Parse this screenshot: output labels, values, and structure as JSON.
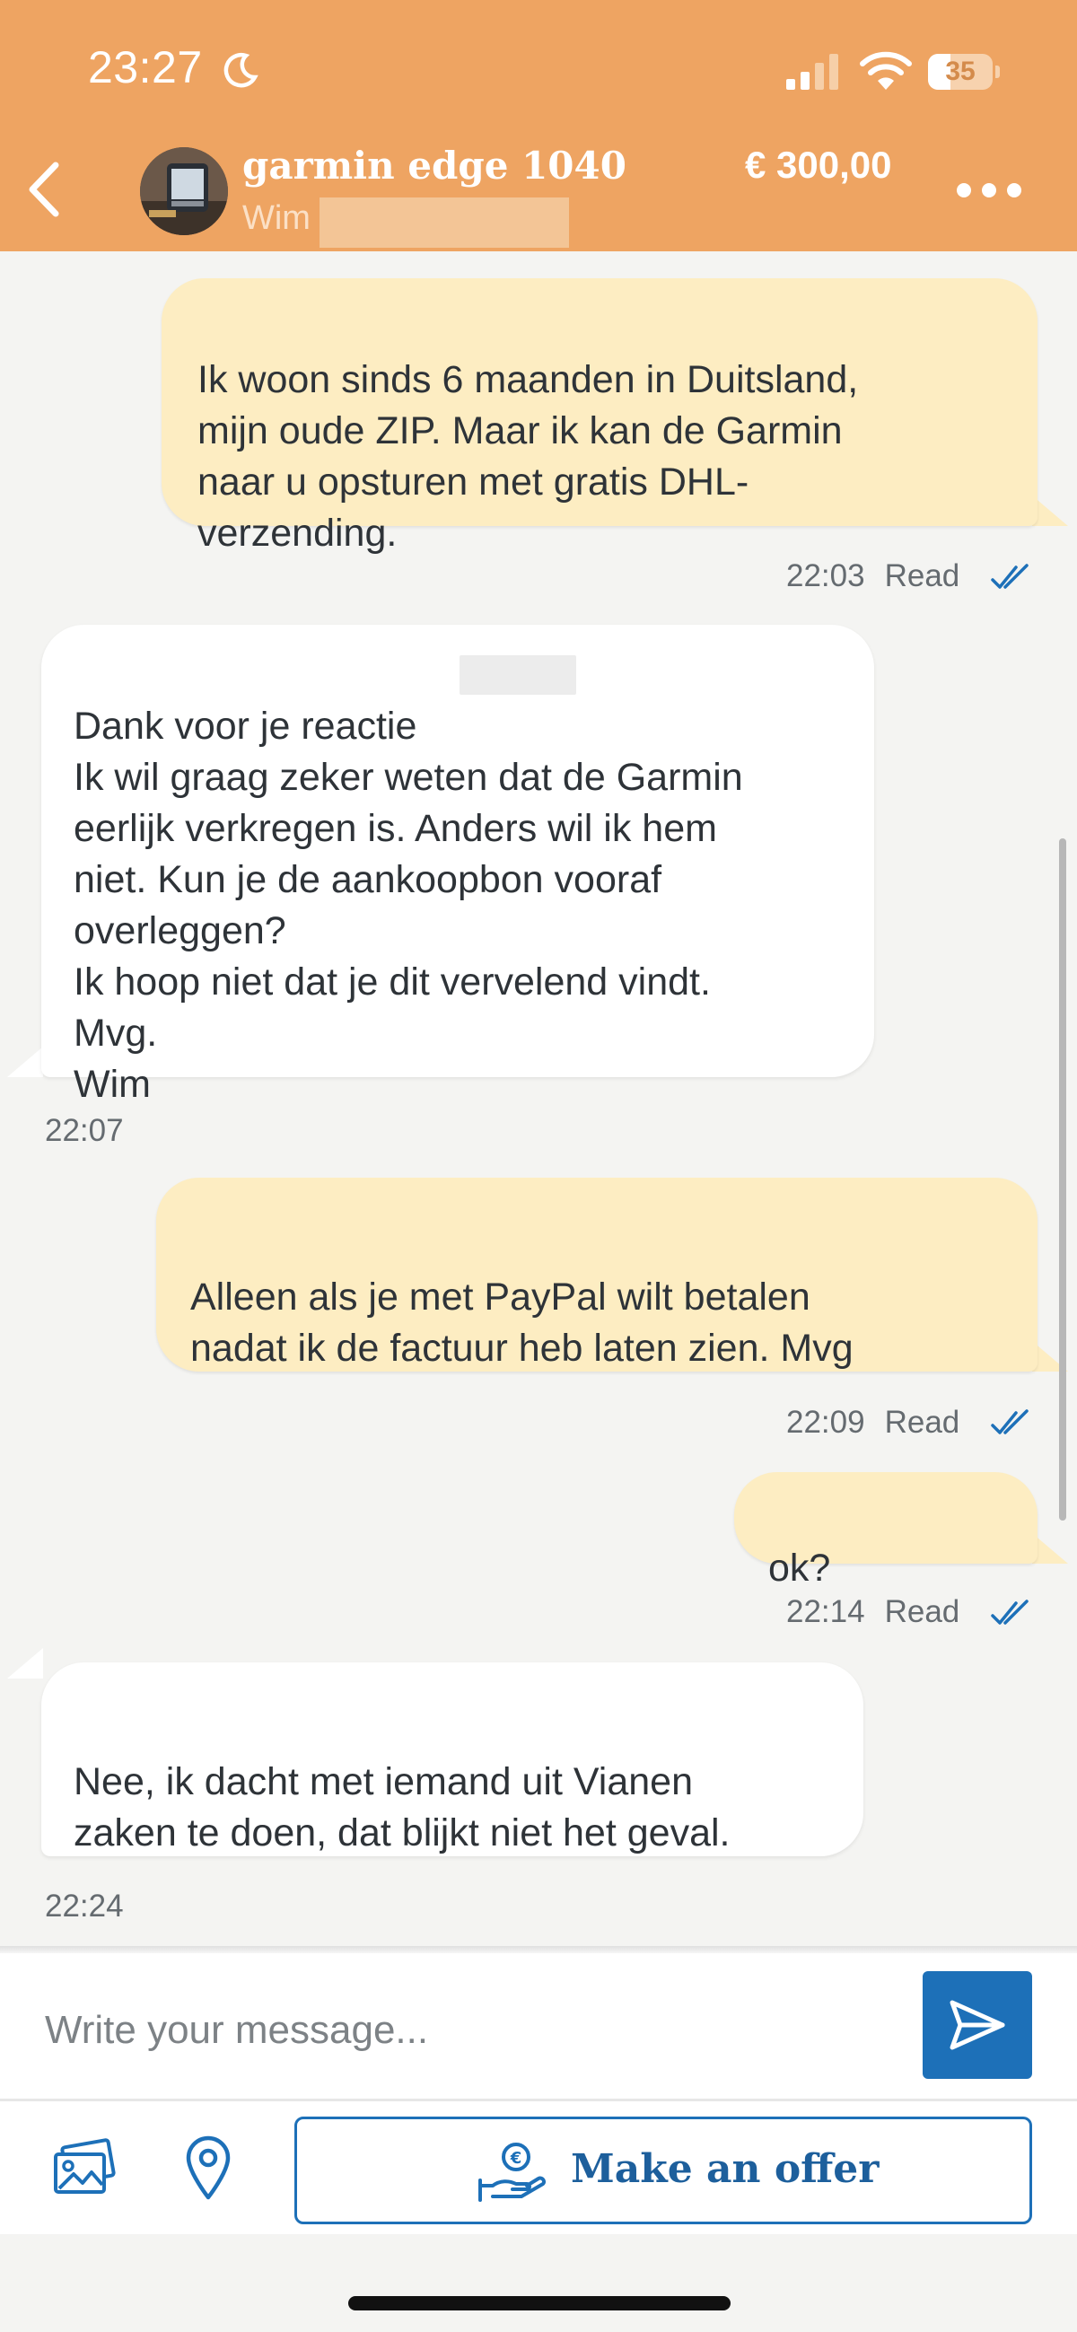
{
  "status_bar": {
    "time": "23:27",
    "battery_text": "35",
    "battery_level": 0.35,
    "icons": [
      "moon-icon",
      "signal-icon",
      "wifi-icon",
      "battery-icon"
    ]
  },
  "header": {
    "title": "garmin edge 1040",
    "seller": "Wim",
    "price": "€ 300,00",
    "back_icon": "chevron-left-icon",
    "menu_icon": "more-horizontal-icon"
  },
  "messages": [
    {
      "direction": "outgoing",
      "text": "Ik woon sinds 6 maanden in Duitsland,\nmijn oude ZIP. Maar ik kan de Garmin\nnaar u opsturen met gratis DHL-\nverzending.",
      "time": "22:03",
      "status": "Read"
    },
    {
      "direction": "incoming",
      "text": "Dank voor je reactie\nIk wil graag zeker weten dat de Garmin\neerlijk verkregen is. Anders wil ik hem\nniet. Kun je de aankoopbon vooraf\noverleggen?\nIk hoop niet dat je dit vervelend vindt.\nMvg.\nWim",
      "time": "22:07"
    },
    {
      "direction": "outgoing",
      "text": "Alleen als je met PayPal wilt betalen\nnadat ik de factuur heb laten zien. Mvg",
      "time": "22:09",
      "status": "Read"
    },
    {
      "direction": "outgoing",
      "text": "ok?",
      "time": "22:14",
      "status": "Read"
    },
    {
      "direction": "incoming",
      "text": "Nee, ik dacht met iemand uit Vianen\nzaken te doen, dat blijkt niet het geval.",
      "time": "22:24"
    }
  ],
  "composer": {
    "placeholder": "Write your message...",
    "send_icon": "send-icon"
  },
  "toolbar": {
    "photo_icon": "photo-icon",
    "location_icon": "location-pin-icon",
    "offer_label": "Make an offer",
    "offer_icon": "euro-hand-icon"
  },
  "colors": {
    "header": "#eea462",
    "outgoing_bubble": "#fdedc2",
    "incoming_bubble": "#ffffff",
    "accent_blue": "#1d70b8",
    "background": "#f4f4f2"
  }
}
